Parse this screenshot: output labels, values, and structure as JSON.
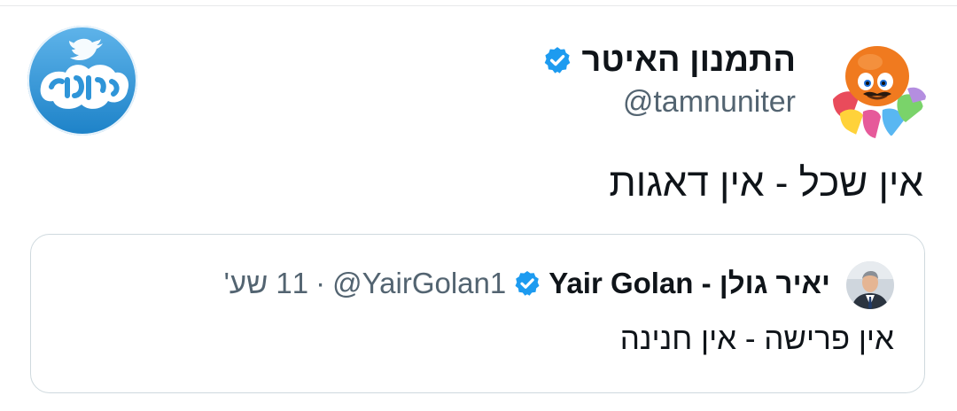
{
  "tweet": {
    "author": {
      "display_name": "התמנון האיטר",
      "handle": "@tamnuniter",
      "verified": true,
      "avatar_icon": "orange-octopus-plush-avatar"
    },
    "site_logo": {
      "icon": "hastatus-twitter-bird-logo",
      "text": "הסטטוס"
    },
    "text": "אין שכל - אין דאגות",
    "quoted": {
      "display_name": "יאיר גולן - Yair Golan",
      "handle": "@YairGolan1",
      "separator": "·",
      "time": "11 שע'",
      "verified": true,
      "avatar_icon": "man-in-suit-avatar",
      "text": "אין פרישה - אין חנינה"
    }
  },
  "colors": {
    "verified_blue": "#1d9bf0",
    "secondary_text": "#536471",
    "border": "#cfd9de",
    "logo_blue": "#2f95d8"
  }
}
